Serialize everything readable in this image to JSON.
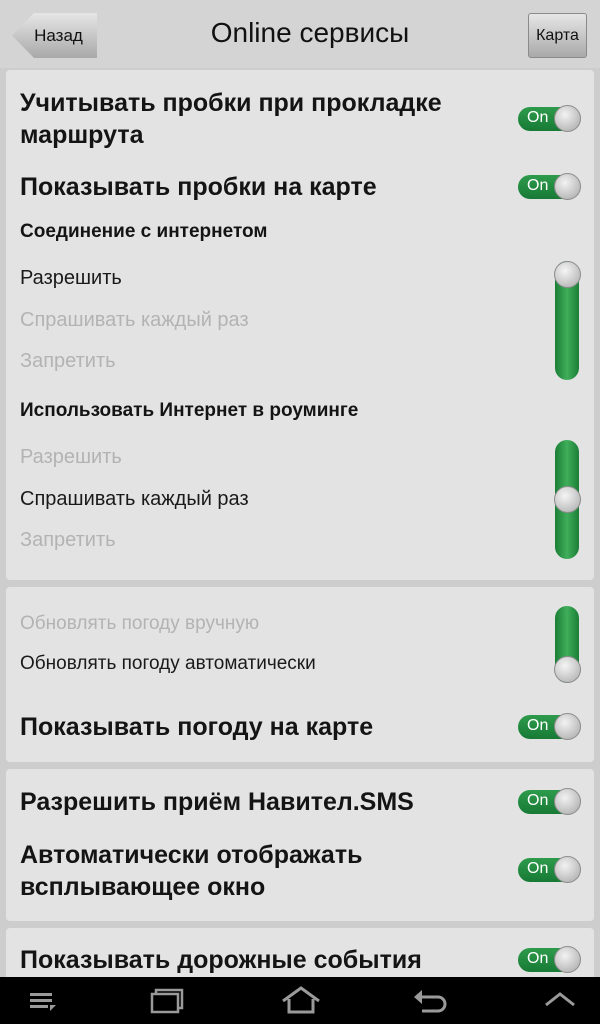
{
  "header": {
    "back_label": "Назад",
    "title": "Online сервисы",
    "map_label": "Карта"
  },
  "section_traffic": {
    "consider_traffic": {
      "label": "Учитывать пробки при прокладке маршрута",
      "state": "On"
    },
    "show_traffic": {
      "label": "Показывать пробки на карте",
      "state": "On"
    },
    "internet": {
      "heading": "Соединение с интернетом",
      "options": [
        "Разрешить",
        "Спрашивать каждый раз",
        "Запретить"
      ],
      "selected": "Разрешить"
    },
    "roaming": {
      "heading": "Использовать Интернет в роуминге",
      "options": [
        "Разрешить",
        "Спрашивать каждый раз",
        "Запретить"
      ],
      "selected": "Спрашивать каждый раз"
    }
  },
  "section_weather": {
    "update": {
      "options": [
        "Обновлять погоду вручную",
        "Обновлять погоду автоматически"
      ],
      "selected": "Обновлять погоду автоматически"
    },
    "show_weather": {
      "label": "Показывать погоду на карте",
      "state": "On"
    }
  },
  "section_sms": {
    "allow_sms": {
      "label": "Разрешить приём Навител.SMS",
      "state": "On"
    },
    "auto_popup": {
      "label": "Автоматически отображать всплывающее окно",
      "state": "On"
    }
  },
  "section_events": {
    "show_events": {
      "label": "Показывать дорожные события",
      "state": "On"
    }
  },
  "navbar": {
    "icons": [
      "menu-icon",
      "recent-apps-icon",
      "home-icon",
      "back-icon",
      "chevron-up-icon"
    ]
  },
  "colors": {
    "accent_green": "#239043",
    "panel_bg": "#e3e3e3",
    "disabled_text": "#b3b3b3"
  }
}
